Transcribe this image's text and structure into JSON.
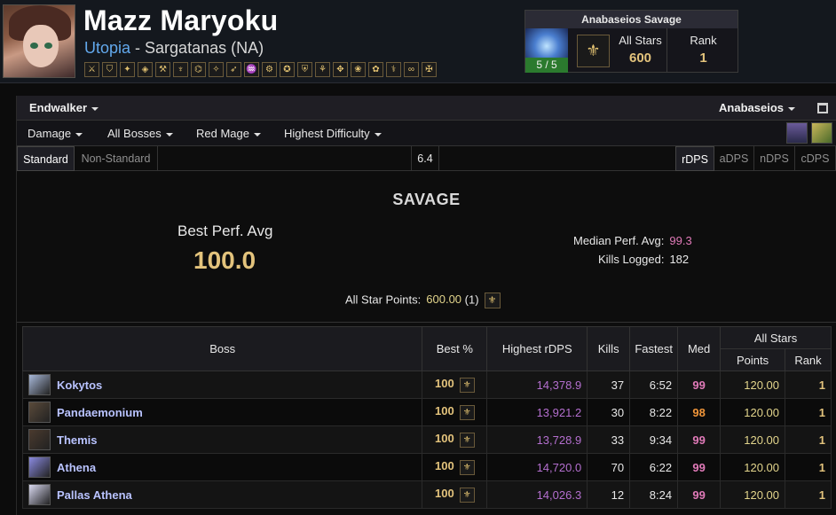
{
  "character": {
    "name": "Mazz Maryoku",
    "world": "Utopia",
    "separator": " - ",
    "datacenter": "Sargatanas (NA)",
    "job_icons": [
      "job-icon-1",
      "job-icon-2",
      "job-icon-3",
      "job-icon-4",
      "job-icon-5",
      "job-icon-6",
      "job-icon-7",
      "job-icon-8",
      "job-icon-9",
      "job-icon-10",
      "job-icon-11",
      "job-icon-12",
      "job-icon-13",
      "job-icon-14",
      "job-icon-15",
      "job-icon-16",
      "job-icon-17",
      "job-icon-18",
      "job-icon-19",
      "job-icon-20"
    ]
  },
  "raid_summary": {
    "title": "Anabaseios Savage",
    "progress": "5 / 5",
    "all_stars_label": "All Stars",
    "all_stars_value": "600",
    "rank_label": "Rank",
    "rank_value": "1"
  },
  "toolbar": {
    "expansion": "Endwalker",
    "zone": "Anabaseios"
  },
  "filters": {
    "metric": "Damage",
    "bosses": "All Bosses",
    "job": "Red Mage",
    "difficulty": "Highest Difficulty"
  },
  "tabs": {
    "standard": "Standard",
    "non_standard": "Non-Standard",
    "version": "6.4",
    "roles": [
      "rDPS",
      "aDPS",
      "nDPS",
      "cDPS"
    ]
  },
  "summary": {
    "difficulty": "SAVAGE",
    "best_perf_label": "Best Perf. Avg",
    "best_perf_value": "100.0",
    "median_label": "Median Perf. Avg:",
    "median_value": "99.3",
    "kills_label": "Kills Logged:",
    "kills_value": "182",
    "all_star_label": "All Star Points:",
    "all_star_value": "600.00",
    "all_star_count": "(1)"
  },
  "table": {
    "headers": {
      "boss": "Boss",
      "best": "Best %",
      "highest": "Highest rDPS",
      "kills": "Kills",
      "fastest": "Fastest",
      "med": "Med",
      "all_stars": "All Stars",
      "points": "Points",
      "rank": "Rank"
    },
    "rows": [
      {
        "boss": "Kokytos",
        "best": "100",
        "highest": "14,378.9",
        "kills": "37",
        "fastest": "6:52",
        "med": "99",
        "med_color": "#e07ab8",
        "points": "120.00",
        "rank": "1",
        "img_color": "#a8b8d8"
      },
      {
        "boss": "Pandaemonium",
        "best": "100",
        "highest": "13,921.2",
        "kills": "30",
        "fastest": "8:22",
        "med": "98",
        "med_color": "#f0953a",
        "points": "120.00",
        "rank": "1",
        "img_color": "#5a4a3a"
      },
      {
        "boss": "Themis",
        "best": "100",
        "highest": "13,728.9",
        "kills": "33",
        "fastest": "9:34",
        "med": "99",
        "med_color": "#e07ab8",
        "points": "120.00",
        "rank": "1",
        "img_color": "#4a3a2e"
      },
      {
        "boss": "Athena",
        "best": "100",
        "highest": "14,720.0",
        "kills": "70",
        "fastest": "6:22",
        "med": "99",
        "med_color": "#e07ab8",
        "points": "120.00",
        "rank": "1",
        "img_color": "#8a8ae0"
      },
      {
        "boss": "Pallas Athena",
        "best": "100",
        "highest": "14,026.3",
        "kills": "12",
        "fastest": "8:24",
        "med": "99",
        "med_color": "#e07ab8",
        "points": "120.00",
        "rank": "1",
        "img_color": "#d8d8f0"
      }
    ]
  }
}
